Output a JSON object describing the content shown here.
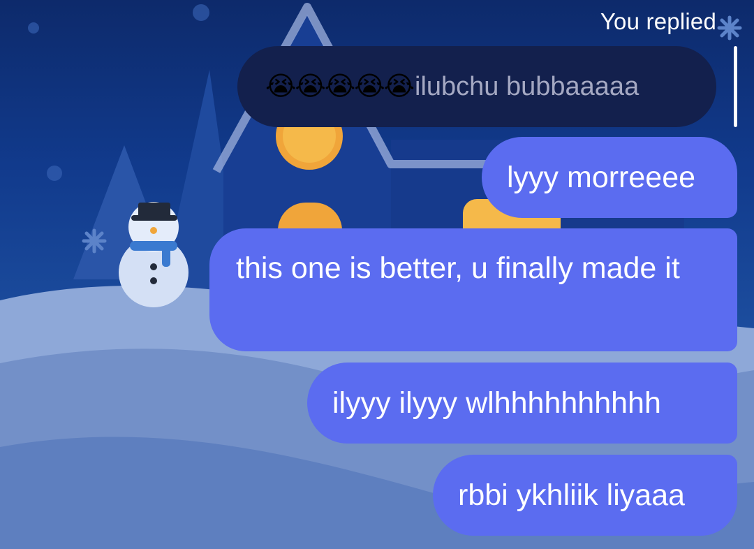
{
  "reply": {
    "label": "You replied",
    "quoted_emojis": "😭😭😭😭😭",
    "quoted_text": "ilubchu bubbaaaaa"
  },
  "messages": [
    {
      "text": "lyyy morreeee"
    },
    {
      "text": "this one is better, u finally made it"
    },
    {
      "text": "ilyyy ilyyy wlhhhhhhhhhh"
    },
    {
      "text": "rbbi ykhliik liyaaa"
    }
  ],
  "colors": {
    "outgoing_bubble": "#5b6cf0",
    "quoted_bubble": "#13204d",
    "background": "#113a8c"
  },
  "icons": [
    "snowman",
    "house",
    "pine-tree",
    "snowflake"
  ]
}
